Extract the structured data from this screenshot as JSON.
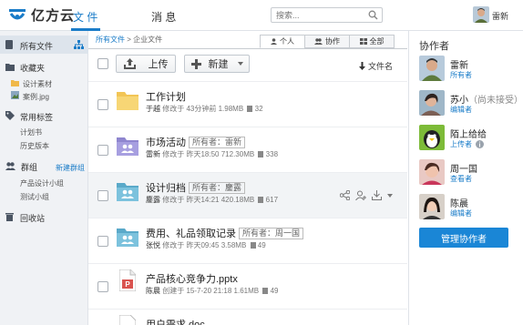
{
  "app": {
    "name": "亿方云",
    "brand_color": "#1a7cc8"
  },
  "topnav": {
    "tabs": [
      {
        "label": "文 件",
        "active": true
      },
      {
        "label": "消 息",
        "active": false
      }
    ],
    "search_placeholder": "搜索...",
    "user_name": "雷新"
  },
  "sidebar": {
    "all_files": "所有文件",
    "favorites": "收藏夹",
    "favorite_items": [
      "设计素材",
      "案例.jpg"
    ],
    "tags": "常用标签",
    "tag_items": [
      "计划书",
      "历史版本"
    ],
    "groups": "群组",
    "new_group": "新建群组",
    "group_items": [
      "产品设计小组",
      "测试小组"
    ],
    "trash": "回收站"
  },
  "main": {
    "breadcrumb": {
      "root": "所有文件",
      "sep": ">",
      "current": "企业文件"
    },
    "view_tabs": [
      {
        "label": "个人",
        "active": true
      },
      {
        "label": "协作",
        "active": false
      },
      {
        "label": "全部",
        "active": false
      }
    ],
    "upload_label": "上传",
    "new_label": "新建",
    "sort_label": "文件名",
    "files": [
      {
        "name": "工作计划",
        "owner": "",
        "author": "于越",
        "action": "修改于",
        "time": "43分钟前",
        "size": "1.98MB",
        "count": "32",
        "type": "folder"
      },
      {
        "name": "市场活动",
        "owner": "所有者：雷新",
        "author": "雷新",
        "action": "修改于",
        "time": "昨天18:50",
        "size": "712.30MB",
        "count": "338",
        "type": "shared-folder"
      },
      {
        "name": "设计归档",
        "owner": "所有者：鏖露",
        "author": "鏖露",
        "action": "修改于",
        "time": "昨天14:21",
        "size": "420.18MB",
        "count": "617",
        "type": "shared-folder"
      },
      {
        "name": "费用、礼品领取记录",
        "owner": "所有者：周一国",
        "author": "张悦",
        "action": "修改于",
        "time": "昨天09:45",
        "size": "3.58MB",
        "count": "49",
        "type": "shared-folder"
      },
      {
        "name": "产品核心竞争力.pptx",
        "owner": "",
        "author": "陈晨",
        "action": "创建于",
        "time": "15-7-20 21:18",
        "size": "1.61MB",
        "count": "49",
        "type": "pptx"
      },
      {
        "name": "用户需求.doc",
        "owner": "",
        "author": "",
        "action": "",
        "time": "",
        "size": "",
        "count": "",
        "type": "doc"
      }
    ]
  },
  "collaborators": {
    "title": "协作者",
    "people": [
      {
        "name": "雷新",
        "note": "",
        "role": "所有者"
      },
      {
        "name": "苏小",
        "note": "（尚未接受）",
        "role": "编辑者"
      },
      {
        "name": "陌上给给",
        "note": "",
        "role": "上传者"
      },
      {
        "name": "周一国",
        "note": "",
        "role": "查看者"
      },
      {
        "name": "陈晨",
        "note": "",
        "role": "编辑者"
      }
    ],
    "manage_label": "管理协作者"
  }
}
